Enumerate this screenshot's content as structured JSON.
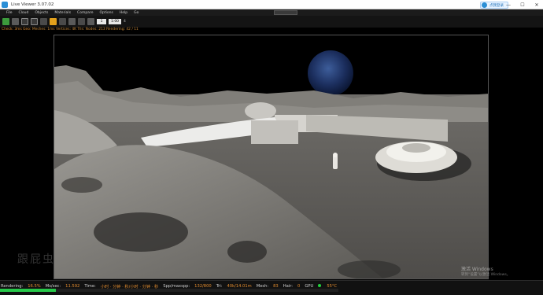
{
  "window": {
    "title": "Live Viewer 3.07.02"
  },
  "login": {
    "label": "点我登录"
  },
  "menu": [
    "File",
    "Cloud",
    "Objects",
    "Materials",
    "Compare",
    "Options",
    "Help",
    "Go"
  ],
  "toolbar": {
    "samples_value": "1",
    "zoom_value": "1:00",
    "zoom_label": "4"
  },
  "info_line": {
    "prefix": "Check: 3ms  Geo: ",
    "items": "Meshes: 1ms  Vertices: 4K  Tris: Nodes: 213  Rendering: 42 / 11"
  },
  "status": {
    "rendering_label": "Rendering:",
    "rendering_value": "16.5%",
    "mssec_label": "Ms/sec:",
    "mssec_value": "11.592",
    "time_label": "Time:",
    "time_value": "小时 · 分钟 · 秒/小时 · 分钟 · 秒",
    "spp_label": "Spp/maxspp:",
    "spp_value": "132/800",
    "tri_label": "Tri:",
    "tri_value": "40k/14.01m",
    "mesh_label": "Mesh:",
    "mesh_value": "83",
    "hair_label": "Hair:",
    "hair_value": "0",
    "gpu_label": "GPU",
    "gpu_value": "55°C",
    "progress": 0.165
  },
  "watermark": {
    "left": "跟屁虫",
    "right_line1": "激活 Windows",
    "right_line2": "转到“设置”以激活 Windows。"
  },
  "colors": {
    "accent_orange": "#e08b2f",
    "status_green": "#27c84a",
    "titlebar_bg": "#ffffff"
  }
}
